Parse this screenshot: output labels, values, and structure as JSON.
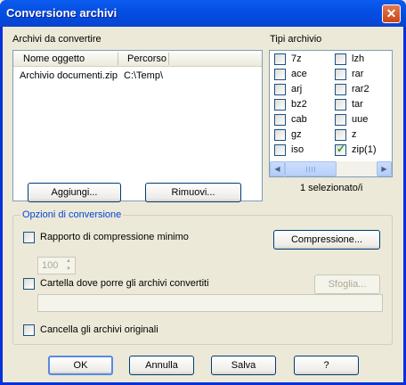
{
  "window": {
    "title": "Conversione archivi",
    "close_glyph": "✕"
  },
  "files": {
    "label": "Archivi da convertire",
    "columns": [
      "Nome oggetto",
      "Percorso"
    ],
    "rows": [
      {
        "name": "Archivio documenti.zip",
        "path": "C:\\Temp\\"
      }
    ]
  },
  "types": {
    "label": "Tipi archivio",
    "items": [
      {
        "label": "7z",
        "checked": false
      },
      {
        "label": "lzh",
        "checked": false
      },
      {
        "label": "ace",
        "checked": false
      },
      {
        "label": "rar",
        "checked": false
      },
      {
        "label": "arj",
        "checked": false
      },
      {
        "label": "rar2",
        "checked": false
      },
      {
        "label": "bz2",
        "checked": false
      },
      {
        "label": "tar",
        "checked": false
      },
      {
        "label": "cab",
        "checked": false
      },
      {
        "label": "uue",
        "checked": false
      },
      {
        "label": "gz",
        "checked": false
      },
      {
        "label": "z",
        "checked": false
      },
      {
        "label": "iso",
        "checked": false
      },
      {
        "label": "zip(1)",
        "checked": true
      }
    ],
    "selected_text": "1 selezionato/i"
  },
  "buttons": {
    "add": "Aggiungi...",
    "remove": "Rimuovi..."
  },
  "options": {
    "group_title": "Opzioni di conversione",
    "min_ratio_label": "Rapporto di compressione minimo",
    "min_ratio_value": "100",
    "compression_button": "Compressione...",
    "target_folder_label": "Cartella dove porre gli archivi convertiti",
    "browse_button": "Sfoglia...",
    "target_folder_value": "",
    "delete_originals_label": "Cancella gli archivi originali"
  },
  "footer": {
    "ok": "OK",
    "cancel": "Annulla",
    "save": "Salva",
    "help": "?"
  }
}
